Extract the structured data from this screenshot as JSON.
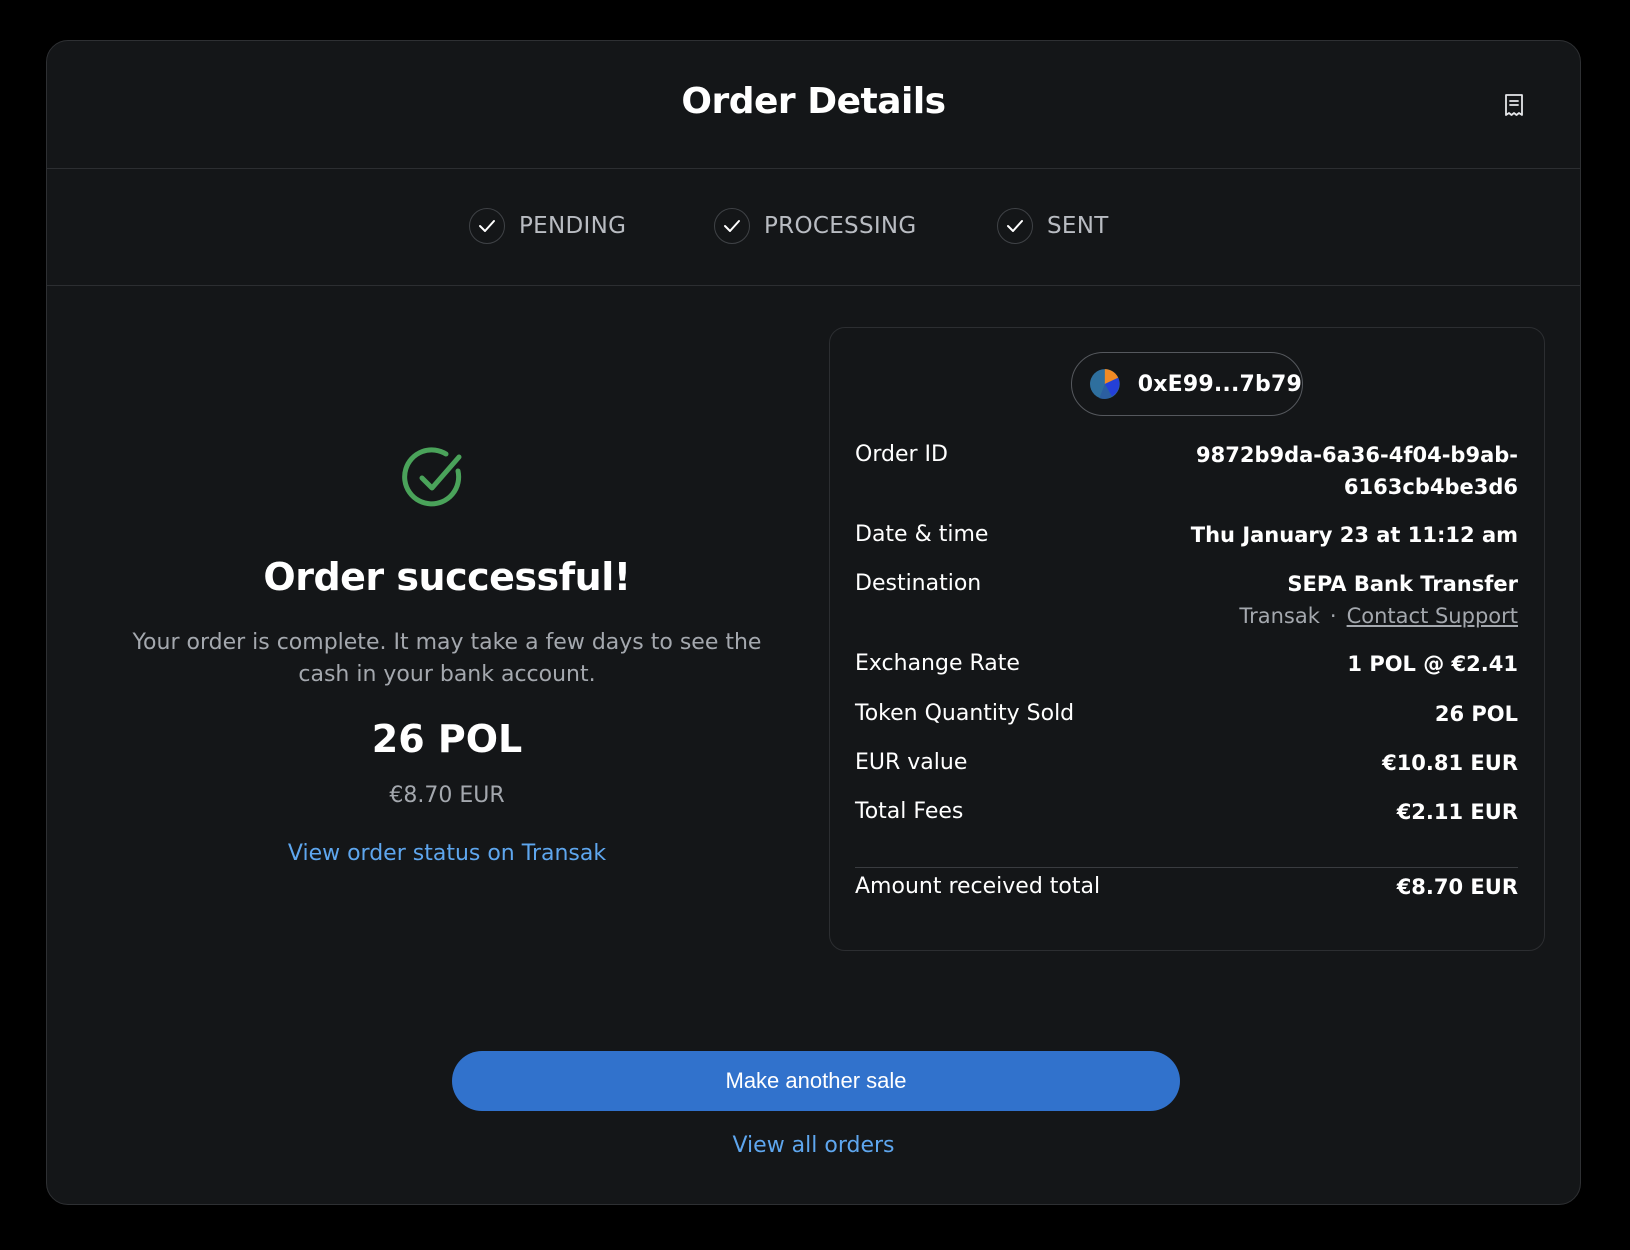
{
  "header": {
    "title": "Order Details",
    "receipt_icon": "receipt-icon"
  },
  "steps": [
    {
      "label": "PENDING",
      "icon": "check-icon"
    },
    {
      "label": "PROCESSING",
      "icon": "check-icon"
    },
    {
      "label": "SENT",
      "icon": "check-icon"
    }
  ],
  "summary": {
    "icon": "check-circle-icon",
    "title": "Order successful!",
    "message": "Your order is complete. It may take a few days to see the cash in your bank account.",
    "amount": "26 POL",
    "fiat_amount": "€8.70 EUR",
    "status_link": "View order status on Transak"
  },
  "details": {
    "address": "0xE99...7b79",
    "rows": [
      {
        "label": "Order ID",
        "value_line1": "9872b9da-6a36-4f04-b9ab-",
        "value_line2": "6163cb4be3d6"
      },
      {
        "label": "Date & time",
        "value": "Thu January 23 at 11:12 am"
      },
      {
        "label": "Destination",
        "value": "SEPA Bank Transfer",
        "provider": "Transak",
        "separator": "·",
        "support_link": "Contact Support"
      },
      {
        "label": "Exchange Rate",
        "value": "1 POL @ €2.41"
      },
      {
        "label": "Token Quantity Sold",
        "value": "26 POL"
      },
      {
        "label": "EUR value",
        "value": "€10.81 EUR"
      },
      {
        "label": "Total Fees",
        "value": "€2.11 EUR"
      },
      {
        "label": "Amount received total",
        "value": "€8.70 EUR"
      }
    ]
  },
  "actions": {
    "primary": "Make another sale",
    "secondary": "View all orders"
  },
  "colors": {
    "accent_blue": "#3172cc",
    "link_blue": "#5ea6ee",
    "success_green": "#4aa35a",
    "background": "#141618"
  }
}
